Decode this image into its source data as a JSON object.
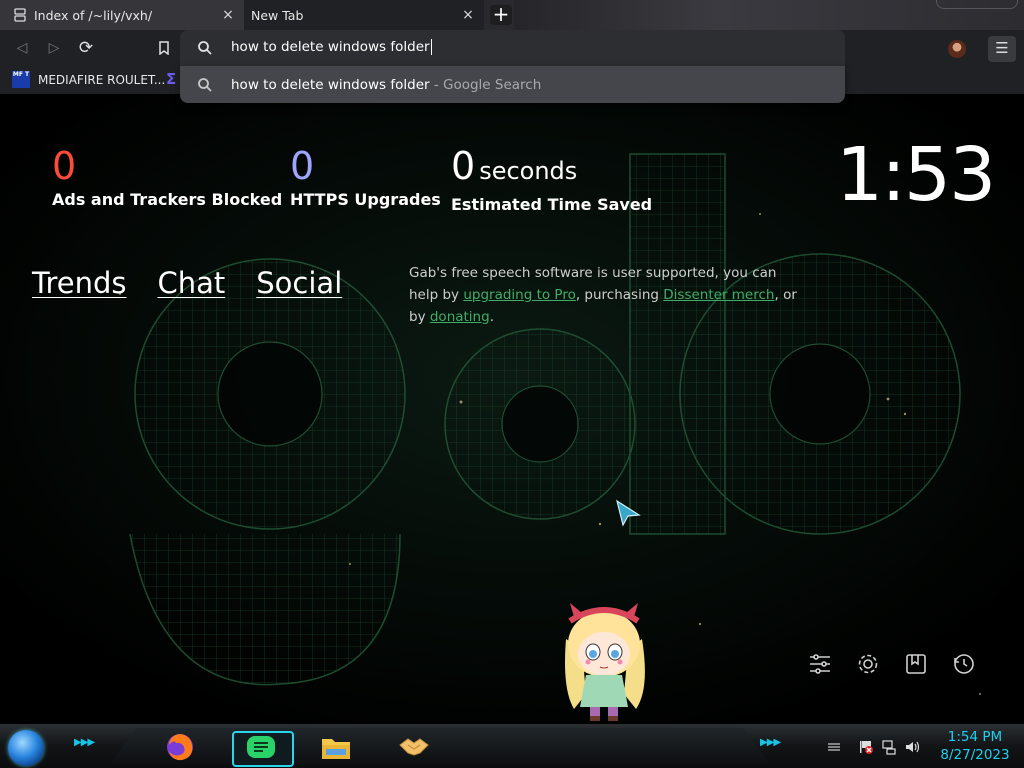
{
  "tabs": [
    {
      "title": "Index of /~lily/vxh/",
      "favicon": "server-icon",
      "close": "×"
    },
    {
      "title": "New Tab",
      "favicon": "none",
      "close": "×"
    }
  ],
  "new_tab_glyph": "+",
  "toolbar": {
    "back": "◁",
    "forward": "▷",
    "reload": "⟳",
    "omnibox_text": "how to delete windows folder",
    "menu_glyph": "☰"
  },
  "bookmarks": [
    {
      "label": "MEDIAFIRE ROULET...",
      "favicon_text": "MF T"
    }
  ],
  "bookmark2_glyph": "Σ",
  "suggestion": {
    "query": "how to delete windows folder",
    "suffix": " - Google Search"
  },
  "stats": [
    {
      "value": "0",
      "unit": "",
      "label": "Ads and Trackers Blocked",
      "color": "#ff4b3a"
    },
    {
      "value": "0",
      "unit": "",
      "label": "HTTPS Upgrades",
      "color": "#a0a5ff"
    },
    {
      "value": "0",
      "unit": "seconds",
      "label": "Estimated Time Saved",
      "color": "#ffffff"
    }
  ],
  "clock": "1:53",
  "links": [
    "Trends",
    "Chat",
    "Social"
  ],
  "gab_message": {
    "p1": "Gab's free speech software is user supported, you can help by ",
    "link1": "upgrading to Pro",
    "p2": ", purchasing ",
    "link2": "Dissenter merch",
    "p3": ", or by ",
    "link3": "donating",
    "p4": "."
  },
  "bottom_icons": [
    "customize-icon",
    "settings-icon",
    "bookmarks-icon",
    "history-icon"
  ],
  "taskbar": {
    "chevrons": "▶▶▶",
    "time": "1:54 PM",
    "date": "8/27/2023",
    "apps": [
      "firefox",
      "messages",
      "file-explorer",
      "handshake"
    ]
  },
  "colors": {
    "accent_cyan": "#1fd0ee",
    "gab_green": "#3fae6a"
  }
}
